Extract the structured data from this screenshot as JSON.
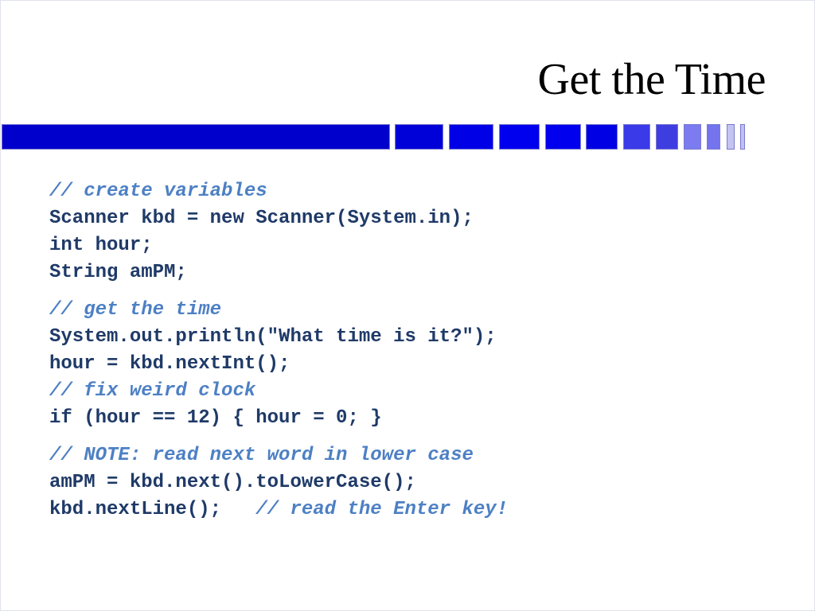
{
  "slide": {
    "title": "Get the Time",
    "header_bar": {
      "segments": [
        {
          "color": "#0000cc"
        },
        {
          "color": "#0000d8"
        },
        {
          "color": "#0000e6"
        },
        {
          "color": "#0000ee"
        },
        {
          "color": "#0000ee"
        },
        {
          "color": "#0000e4"
        },
        {
          "color": "#3a3ae8"
        },
        {
          "color": "#3e3ee0"
        },
        {
          "color": "#7c7cf0"
        },
        {
          "color": "#7474ee"
        },
        {
          "color": "#c4c4f2"
        },
        {
          "color": "#c0c0ee"
        }
      ]
    },
    "colors": {
      "code": "#1f3a68",
      "comment": "#4d80c4"
    },
    "code_lines": [
      {
        "code": "",
        "comment": "// create variables"
      },
      {
        "code": "Scanner kbd = new Scanner(System.in);",
        "comment": ""
      },
      {
        "code": "int hour;",
        "comment": ""
      },
      {
        "code": "String amPM;",
        "comment": ""
      },
      {
        "code": "",
        "comment": "// get the time"
      },
      {
        "code": "System.out.println(\"What time is it?\");",
        "comment": ""
      },
      {
        "code": "hour = kbd.nextInt();",
        "comment": ""
      },
      {
        "code": "",
        "comment": "// fix weird clock"
      },
      {
        "code": "if (hour == 12) { hour = 0; }",
        "comment": ""
      },
      {
        "code": "",
        "comment": "// NOTE: read next word in lower case"
      },
      {
        "code": "amPM = kbd.next().toLowerCase();",
        "comment": ""
      },
      {
        "code": "kbd.nextLine();   ",
        "comment": "// read the Enter key!"
      }
    ]
  }
}
